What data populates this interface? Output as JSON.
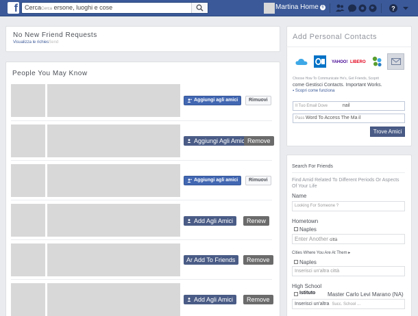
{
  "topbar": {
    "logo": "f",
    "search_value": "Cerca",
    "search_placeholder_small": "Cerca",
    "search_placeholder": "ersone, luoghi e cose",
    "user_name": "Martina Home",
    "user_badge": "6"
  },
  "friend_requests": {
    "title": "No New Friend Requests",
    "link_main": "Visualizza le richies",
    "link_faded": "Send"
  },
  "pymk": {
    "title": "People You May Know",
    "rows": [
      {
        "add": "Aggiungi agli amici",
        "remove": "Rimuovi"
      },
      {
        "add": "Aggiungi Agli Amici",
        "remove": "Remove"
      },
      {
        "add": "Aggiungi agli amici",
        "remove": "Rimuovi"
      },
      {
        "add": "Add Agli Amici",
        "remove": "Renew"
      },
      {
        "add": "Ar Add To Friends",
        "remove": "Remove"
      },
      {
        "add": "Add Agli Amici",
        "remove": "Remove"
      }
    ]
  },
  "contacts": {
    "title": "Add Personal Contacts",
    "providers": [
      {
        "name": "iCloud",
        "icon": "cloud-icon",
        "color": "#3ea8e6"
      },
      {
        "name": "Outlook",
        "icon": "outlook-icon",
        "color": "#0072c6"
      },
      {
        "name": "YAHOO!",
        "icon": "yahoo-icon",
        "color": "#400191"
      },
      {
        "name": "LIBERO",
        "icon": "libero-icon",
        "color": "#e3001b"
      },
      {
        "name": "",
        "icon": "people-icon",
        "color": "#5a9e2f"
      },
      {
        "name": "",
        "icon": "mail-icon",
        "color": "#6b7a99"
      }
    ],
    "desc_line1": "Choose How To Communicate He's, Get Friends, Scoprit",
    "desc_line2_a": "come",
    "desc_line2_b": "Gestisci Contacts. Important Works.",
    "desc_line3": "Scopri come funziona",
    "email_label": "Il Tuo Email Dove",
    "email_value": "nail",
    "password_label": "Pass",
    "password_value": "Word To Access The Ma",
    "password_suffix": "il",
    "find_button": "Trove Amici"
  },
  "search_friends": {
    "title": "Search For Friends",
    "desc": "Find Amid Related To Different Periods Or Aspects Of Your Life",
    "name_label": "Name",
    "name_placeholder": "Looking For Someone ?",
    "hometown_label": "Hometown",
    "hometown_option": "Naples",
    "hometown_placeholder": "Enter Another",
    "hometown_suffix": "città",
    "cities_label": "Cities Where You Are At Them",
    "cities_option": "Naples",
    "cities_placeholder": "Inserisci un'altra città",
    "highschool_label": "High School",
    "highschool_option_a": "Istituto",
    "highschool_option_b": "Master Carlo Levi Marano (NA)",
    "highschool_placeholder": "Inserisci un'altra",
    "highschool_suffix": "Succ. School ..."
  },
  "colors": {
    "brand": "#3b5998",
    "button": "#4267b2",
    "background": "#e9ebee"
  }
}
